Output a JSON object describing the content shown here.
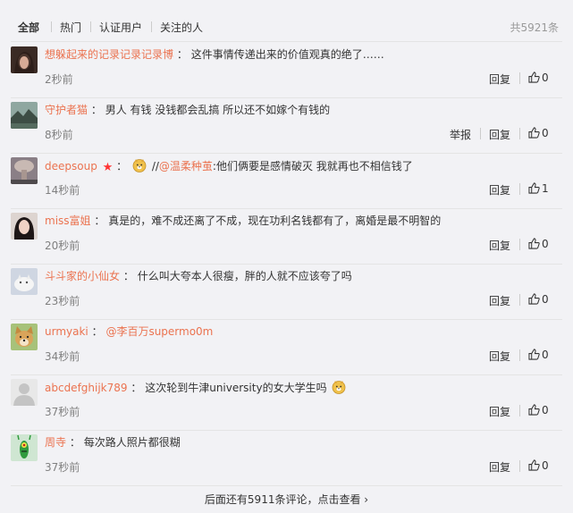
{
  "tabs": [
    {
      "label": "全部"
    },
    {
      "label": "热门"
    },
    {
      "label": "认证用户"
    },
    {
      "label": "关注的人"
    }
  ],
  "total": "共5921条",
  "colors": {
    "accent": "#eb7350",
    "muted": "#808080",
    "divider": "#e4e4e4"
  },
  "actions": {
    "reply": "回复",
    "report": "举报"
  },
  "comments": [
    {
      "user": "想躲起来的记录记录记录博",
      "colon": "：",
      "text": "这件事情传递出来的价值观真的绝了……",
      "time": "2秒前",
      "likes": "0",
      "avatar": "avatar-dark-hair"
    },
    {
      "user": "守护者猫",
      "colon": "：",
      "text": "男人 有钱 没钱都会乱搞 所以还不如嫁个有钱的",
      "time": "8秒前",
      "likes": "0",
      "avatar": "avatar-landscape"
    },
    {
      "user": "deepsoup",
      "colon": "：",
      "pre": "//",
      "mention": "@温柔种茧",
      "text": ":他们俩要是感情破灭 我就再也不相信钱了",
      "time": "14秒前",
      "likes": "1",
      "avatar": "avatar-explosion"
    },
    {
      "user": "miss富姐",
      "colon": "：",
      "text": "真是的，难不成还离了不成，现在功利名钱都有了，离婚是最不明智的",
      "time": "20秒前",
      "likes": "0",
      "avatar": "avatar-girl"
    },
    {
      "user": "斗斗家的小仙女",
      "colon": "：",
      "text": "什么叫大夸本人很瘦，胖的人就不应该夸了吗",
      "time": "23秒前",
      "likes": "0",
      "avatar": "avatar-cat"
    },
    {
      "user": "urmyaki",
      "colon": "：",
      "mention": "@李百万supermo0m",
      "text": "",
      "time": "34秒前",
      "likes": "0",
      "avatar": "avatar-dog"
    },
    {
      "user": "abcdefghijk789",
      "colon": "：",
      "text": "这次轮到牛津university的女大学生吗",
      "time": "37秒前",
      "likes": "0",
      "avatar": "avatar-default"
    },
    {
      "user": "周寺",
      "colon": "：",
      "text": "每次路人照片都很糊",
      "time": "37秒前",
      "likes": "0",
      "avatar": "avatar-plankton"
    }
  ],
  "more": "后面还有5911条评论，点击查看 ›"
}
